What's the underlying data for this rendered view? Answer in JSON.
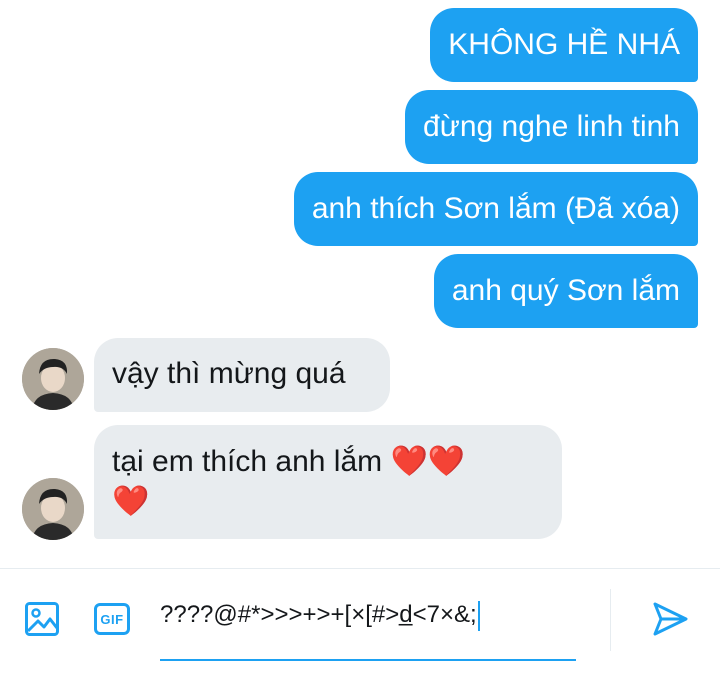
{
  "messages_sent": [
    "KHÔNG HỀ NHÁ",
    "đừng nghe linh tinh",
    "anh thích Sơn lắm (Đã xóa)",
    "anh quý Sơn lắm"
  ],
  "messages_received": [
    "vậy thì mừng quá",
    "tại em thích anh lắm ❤️❤️",
    "❤️"
  ],
  "composer": {
    "gif_label": "GIF",
    "input_value": "????@#*>>>+>+[×[#>d̲<7×&;"
  },
  "icons": {
    "image": "image-icon",
    "gif": "gif-icon",
    "send": "send-icon"
  },
  "colors": {
    "accent": "#1da1f2",
    "incoming_bubble": "#e8ecef",
    "heart": "#e0245e"
  }
}
